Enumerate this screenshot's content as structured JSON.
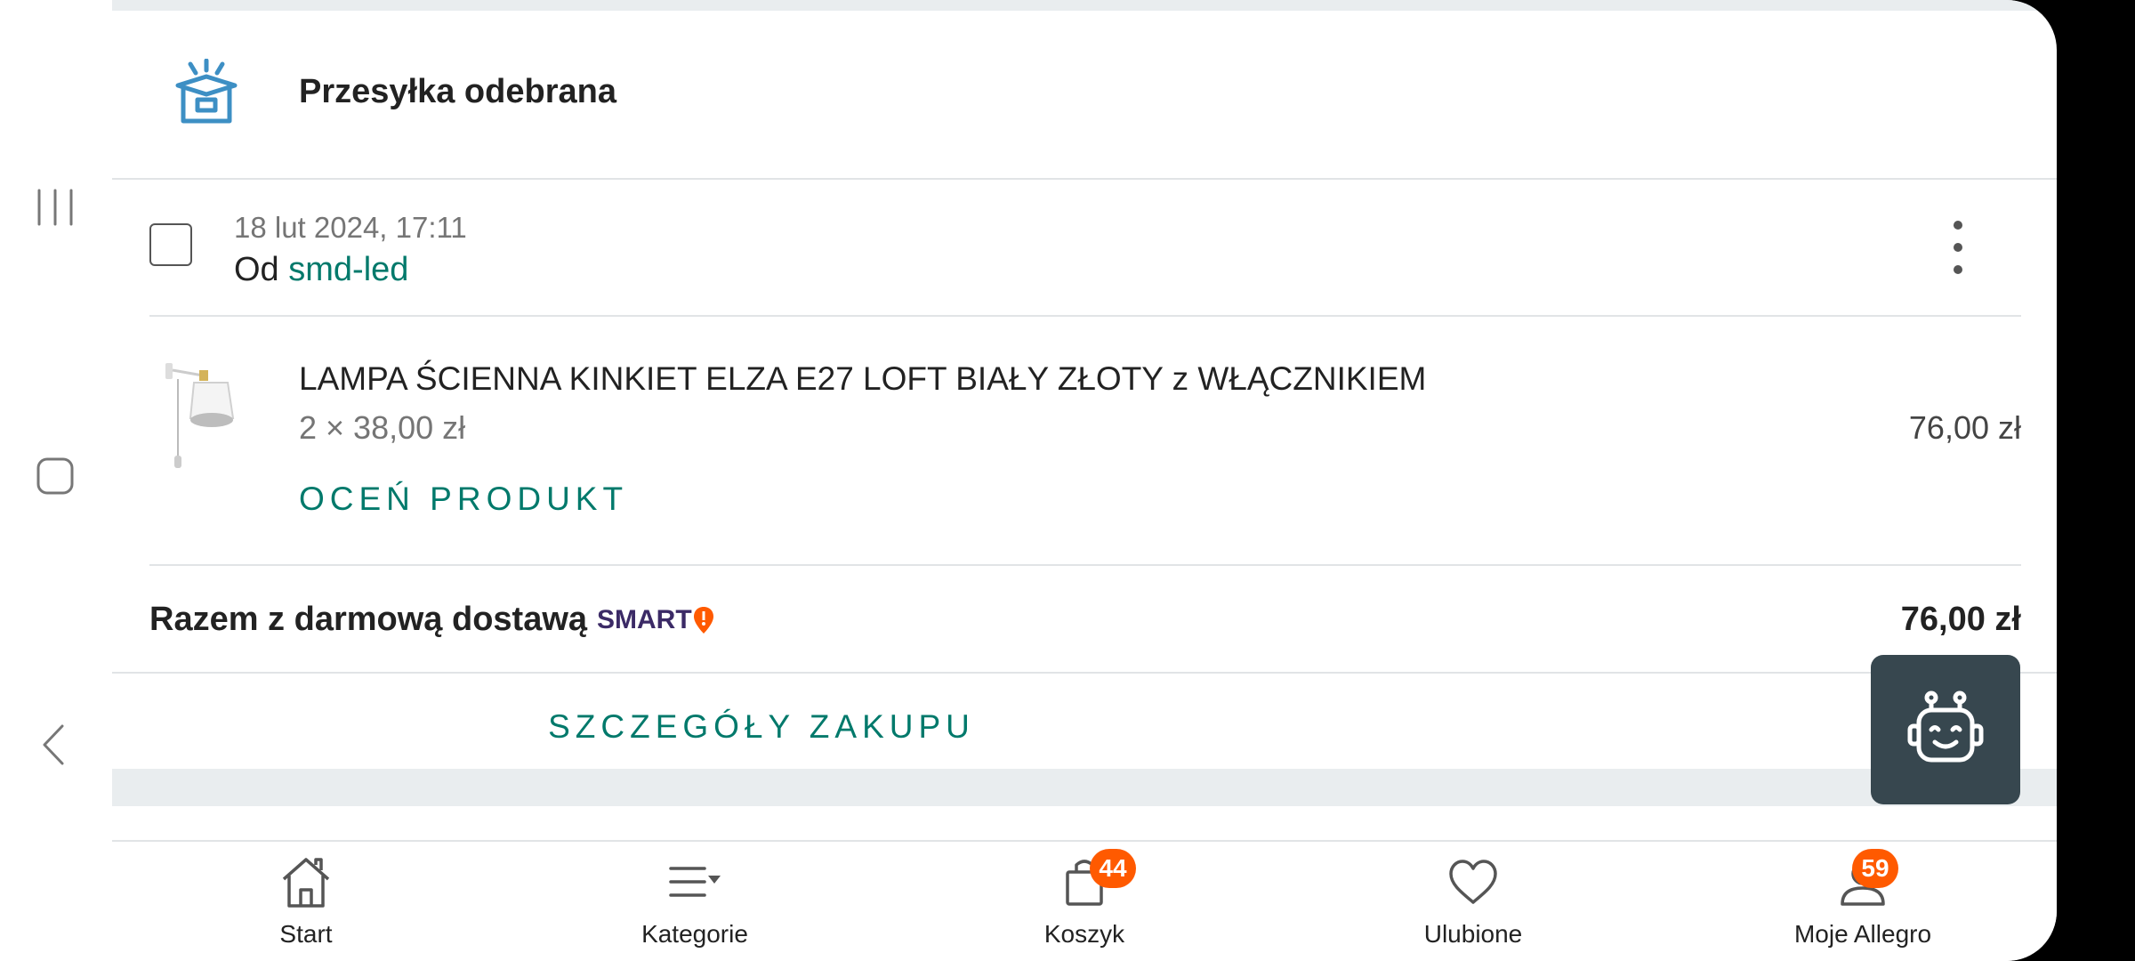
{
  "shipment": {
    "status_title": "Przesyłka odebrana"
  },
  "order": {
    "date": "18 lut 2024, 17:11",
    "seller_prefix": "Od",
    "seller_name": "smd-led"
  },
  "product": {
    "name": "LAMPA ŚCIENNA KINKIET ELZA E27 LOFT BIAŁY ZŁOTY z WŁĄCZNIKIEM",
    "quantity_price": "2 × 38,00 zł",
    "total_price": "76,00 zł",
    "rate_label": "OCEŃ PRODUKT"
  },
  "summary": {
    "label": "Razem z darmową dostawą",
    "smart_badge": "SMART",
    "total": "76,00 zł"
  },
  "details_button": "SZCZEGÓŁY ZAKUPU",
  "bottom_nav": {
    "start": "Start",
    "categories": "Kategorie",
    "cart": "Koszyk",
    "cart_badge": "44",
    "favorites": "Ulubione",
    "my_allegro": "Moje Allegro",
    "my_allegro_badge": "59"
  },
  "colors": {
    "accent": "#00796b",
    "badge": "#ff5a00",
    "fab": "#37474f",
    "smart": "#3b2a66"
  }
}
